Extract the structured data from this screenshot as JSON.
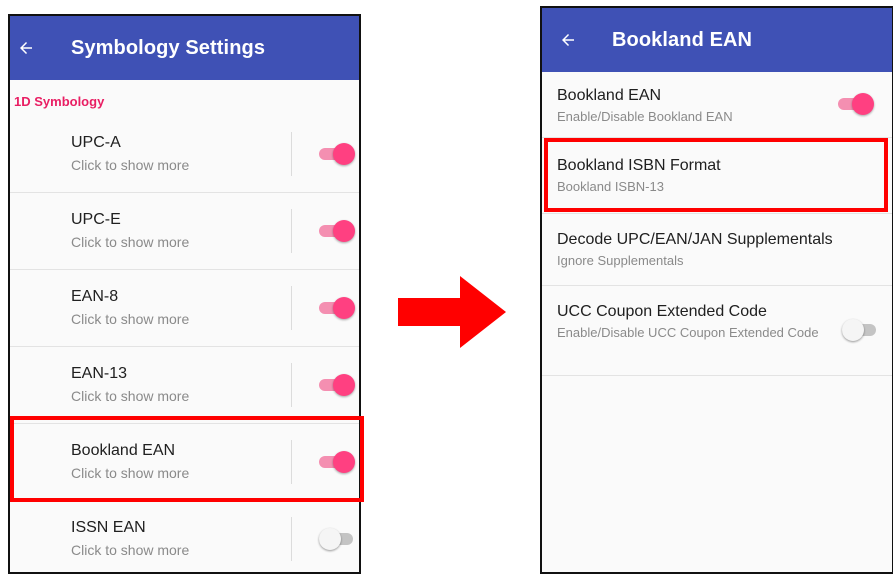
{
  "left_screen": {
    "title": "Symbology Settings",
    "section": "1D Symbology",
    "items": [
      {
        "label": "UPC-A",
        "sub": "Click to show more",
        "enabled": true
      },
      {
        "label": "UPC-E",
        "sub": "Click to show more",
        "enabled": true
      },
      {
        "label": "EAN-8",
        "sub": "Click to show more",
        "enabled": true
      },
      {
        "label": "EAN-13",
        "sub": "Click to show more",
        "enabled": true
      },
      {
        "label": "Bookland EAN",
        "sub": "Click to show more",
        "enabled": true
      },
      {
        "label": "ISSN EAN",
        "sub": "Click to show more",
        "enabled": false
      }
    ]
  },
  "right_screen": {
    "title": "Bookland EAN",
    "items": [
      {
        "label": "Bookland EAN",
        "sub": "Enable/Disable Bookland EAN",
        "enabled": true
      },
      {
        "label": "Bookland ISBN Format",
        "sub": "Bookland ISBN-13"
      },
      {
        "label": "Decode UPC/EAN/JAN Supplementals",
        "sub": "Ignore Supplementals"
      },
      {
        "label": "UCC Coupon Extended Code",
        "sub": "Enable/Disable UCC Coupon Extended Code",
        "enabled": false
      }
    ]
  },
  "icons": {
    "back": "arrow-left-icon",
    "transition": "arrow-right-icon"
  },
  "colors": {
    "appbar": "#3f51b5",
    "accent": "#ff4081",
    "section": "#e91e63",
    "highlight": "#ff0000"
  }
}
